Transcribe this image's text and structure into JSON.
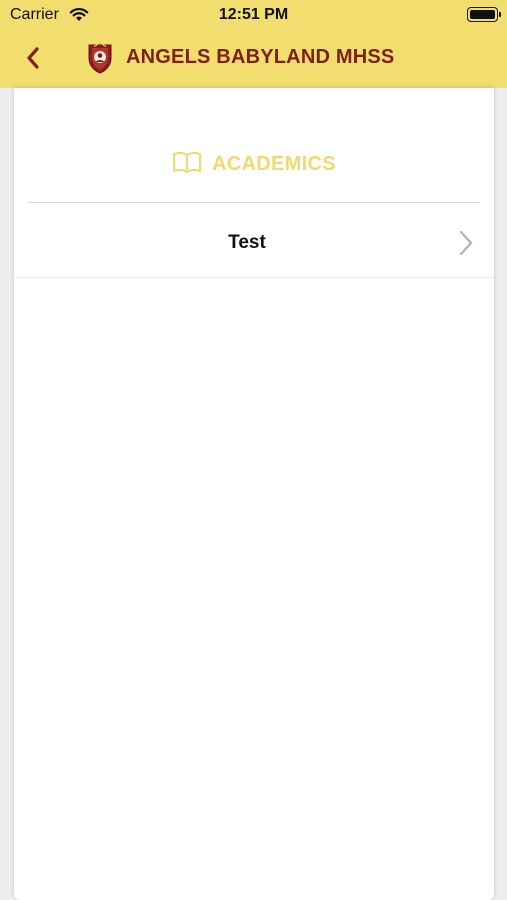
{
  "status_bar": {
    "carrier": "Carrier",
    "time": "12:51 PM",
    "icons": [
      "wifi-icon",
      "battery-icon"
    ]
  },
  "header": {
    "back_icon": "chevron-left-icon",
    "logo": "school-crest-icon",
    "title": "ANGELS BABYLAND MHSS"
  },
  "section": {
    "icon": "open-book-icon",
    "title": "ACADEMICS"
  },
  "list": {
    "items": [
      {
        "label": "Test",
        "icon": "chevron-right-icon"
      }
    ]
  },
  "colors": {
    "header_bg": "#f2de6f",
    "brand": "#7f1f17",
    "section_accent": "#f0da6e"
  }
}
